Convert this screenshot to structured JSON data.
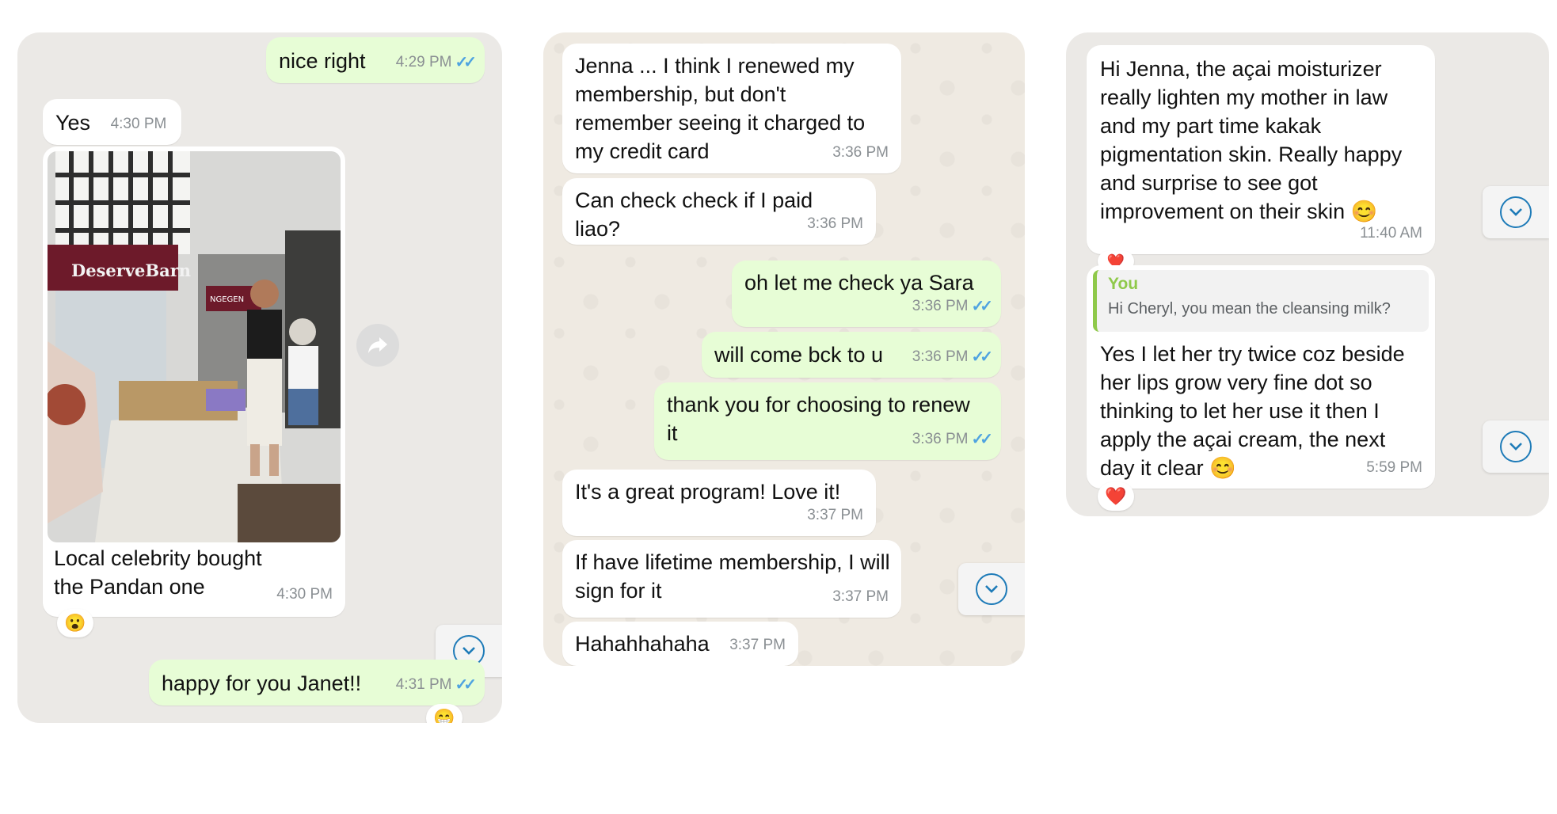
{
  "panel1": {
    "msg1": {
      "text": "nice right",
      "time": "4:29 PM"
    },
    "msg2": {
      "text": "Yes",
      "time": "4:30 PM"
    },
    "photo": {
      "sign_text": "DeserveBarn",
      "sign2_text": "NGEGEN",
      "caption": "Local celebrity bought the Pandan one",
      "time": "4:30 PM"
    },
    "msg4": {
      "text": "happy for you Janet!!",
      "time": "4:31 PM"
    }
  },
  "panel2": {
    "msg1": {
      "text": "Jenna ... I think I renewed my membership, but don't remember seeing it charged to my credit card",
      "time": "3:36 PM"
    },
    "msg2": {
      "text": "Can check check if I paid liao?",
      "time": "3:36 PM"
    },
    "msg3": {
      "text": "oh let me check ya Sara",
      "time": "3:36 PM"
    },
    "msg4": {
      "text": "will come bck to u",
      "time": "3:36 PM"
    },
    "msg5": {
      "text": "thank you for choosing to renew it",
      "time": "3:36 PM"
    },
    "msg6": {
      "text": "It's a great program! Love it!",
      "time": "3:37 PM"
    },
    "msg7": {
      "text": "If have lifetime membership, I will sign for it",
      "time": "3:37 PM"
    },
    "msg8": {
      "text": "Hahahhahaha",
      "time": "3:37 PM"
    }
  },
  "panel3": {
    "msg1": {
      "text": "Hi Jenna, the açai moisturizer really lighten my mother in law and my part time kakak pigmentation skin. Really happy and surprise to see got improvement on their skin 😊",
      "time": "11:40 AM"
    },
    "msg2": {
      "quote_author": "You",
      "quote_text": "Hi Cheryl, you mean the cleansing milk?",
      "text": "Yes I let her try twice coz beside her lips grow very fine dot so thinking to let her use it then I apply the açai cream, the next day it clear 😊",
      "time": "5:59 PM"
    }
  },
  "icons": {
    "read_receipt": "double-check-icon",
    "scroll_down": "chevron-down-icon",
    "forward": "forward-icon",
    "reaction_surprised": "😮",
    "reaction_heart": "❤️",
    "reaction_grin": "😁"
  },
  "colors": {
    "incoming_bubble": "#ffffff",
    "outgoing_bubble": "#e7fdd6",
    "read_tick": "#4fa3e0",
    "quote_accent": "#8fc94a"
  }
}
